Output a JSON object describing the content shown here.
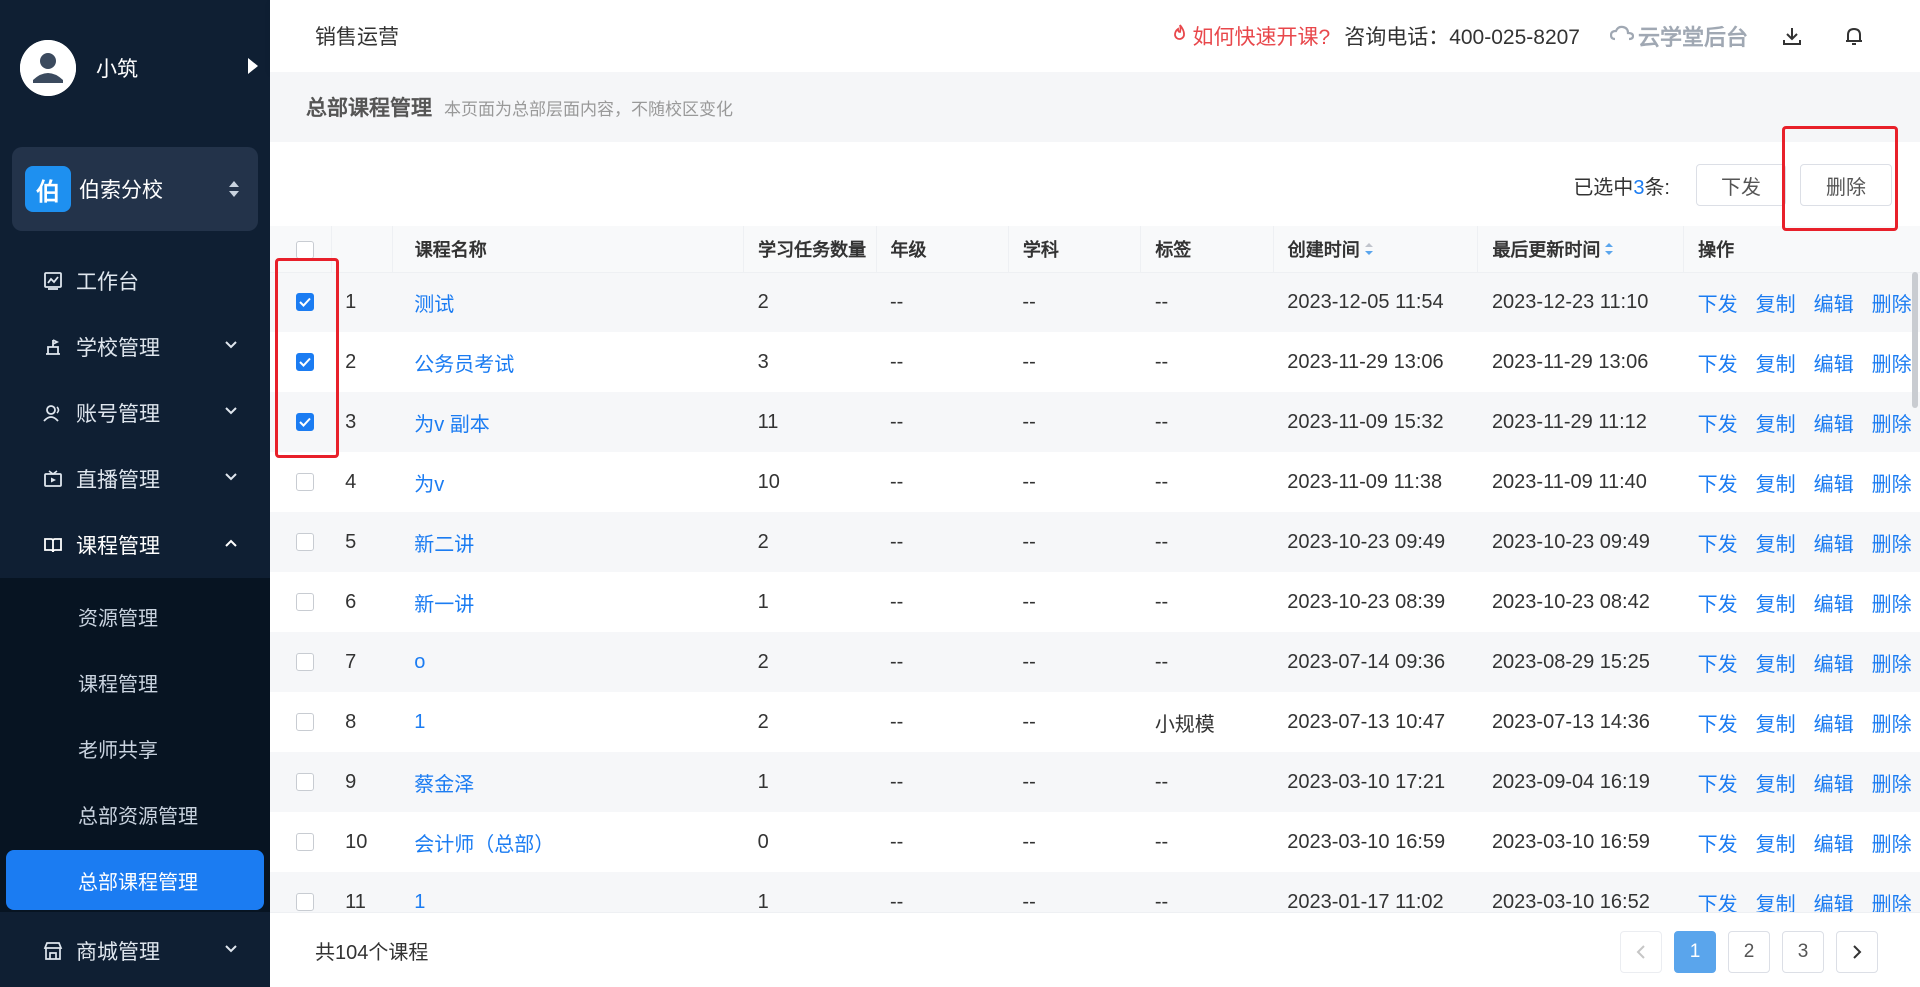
{
  "sidebar": {
    "user_name": "小筑",
    "school": {
      "logo_char": "伯",
      "name": "伯索分校"
    },
    "items": [
      {
        "label": "工作台",
        "icon": "dashboard-icon"
      },
      {
        "label": "学校管理",
        "icon": "school-icon"
      },
      {
        "label": "账号管理",
        "icon": "user-icon"
      },
      {
        "label": "直播管理",
        "icon": "live-icon"
      },
      {
        "label": "课程管理",
        "icon": "book-icon"
      },
      {
        "label": "商城管理",
        "icon": "store-icon"
      }
    ],
    "submenu": [
      "资源管理",
      "课程管理",
      "老师共享",
      "总部资源管理",
      "总部课程管理"
    ]
  },
  "header": {
    "title": "销售运营",
    "quick_link": "如何快速开课?",
    "phone": "咨询电话：400-025-8207",
    "brand": "云学堂后台"
  },
  "page": {
    "title": "总部课程管理",
    "description": "本页面为总部层面内容，不随校区变化"
  },
  "toolbar": {
    "selected_prefix": "已选中",
    "selected_count": "3",
    "selected_suffix": "条:",
    "send_label": "下发",
    "delete_label": "删除"
  },
  "table": {
    "headers": {
      "name": "课程名称",
      "tasks": "学习任务数量",
      "grade": "年级",
      "subject": "学科",
      "tag": "标签",
      "created": "创建时间",
      "updated": "最后更新时间",
      "ops": "操作"
    },
    "op_labels": [
      "下发",
      "复制",
      "编辑",
      "删除"
    ],
    "rows": [
      {
        "idx": "1",
        "name": "测试",
        "tasks": "2",
        "grade": "--",
        "subject": "--",
        "tag": "--",
        "created": "2023-12-05 11:54",
        "updated": "2023-12-23 11:10",
        "checked": true
      },
      {
        "idx": "2",
        "name": "公务员考试",
        "tasks": "3",
        "grade": "--",
        "subject": "--",
        "tag": "--",
        "created": "2023-11-29 13:06",
        "updated": "2023-11-29 13:06",
        "checked": true
      },
      {
        "idx": "3",
        "name": "为v 副本",
        "tasks": "11",
        "grade": "--",
        "subject": "--",
        "tag": "--",
        "created": "2023-11-09 15:32",
        "updated": "2023-11-29 11:12",
        "checked": true
      },
      {
        "idx": "4",
        "name": "为v",
        "tasks": "10",
        "grade": "--",
        "subject": "--",
        "tag": "--",
        "created": "2023-11-09 11:38",
        "updated": "2023-11-09 11:40",
        "checked": false
      },
      {
        "idx": "5",
        "name": "新二讲",
        "tasks": "2",
        "grade": "--",
        "subject": "--",
        "tag": "--",
        "created": "2023-10-23 09:49",
        "updated": "2023-10-23 09:49",
        "checked": false
      },
      {
        "idx": "6",
        "name": "新一讲",
        "tasks": "1",
        "grade": "--",
        "subject": "--",
        "tag": "--",
        "created": "2023-10-23 08:39",
        "updated": "2023-10-23 08:42",
        "checked": false
      },
      {
        "idx": "7",
        "name": "o",
        "tasks": "2",
        "grade": "--",
        "subject": "--",
        "tag": "--",
        "created": "2023-07-14 09:36",
        "updated": "2023-08-29 15:25",
        "checked": false
      },
      {
        "idx": "8",
        "name": "1",
        "tasks": "2",
        "grade": "--",
        "subject": "--",
        "tag": "小规模",
        "created": "2023-07-13 10:47",
        "updated": "2023-07-13 14:36",
        "checked": false
      },
      {
        "idx": "9",
        "name": "蔡金泽",
        "tasks": "1",
        "grade": "--",
        "subject": "--",
        "tag": "--",
        "created": "2023-03-10 17:21",
        "updated": "2023-09-04 16:19",
        "checked": false
      },
      {
        "idx": "10",
        "name": "会计师（总部）",
        "tasks": "0",
        "grade": "--",
        "subject": "--",
        "tag": "--",
        "created": "2023-03-10 16:59",
        "updated": "2023-03-10 16:59",
        "checked": false
      },
      {
        "idx": "11",
        "name": "1",
        "tasks": "1",
        "grade": "--",
        "subject": "--",
        "tag": "--",
        "created": "2023-01-17 11:02",
        "updated": "2023-03-10 16:52",
        "checked": false
      }
    ]
  },
  "footer": {
    "total": "共104个课程",
    "pages": [
      "1",
      "2",
      "3"
    ],
    "current_page": "1"
  },
  "colors": {
    "sidebar_bg": "#0f1f33",
    "accent": "#1b7cf2",
    "highlight": "#e8202a",
    "quick_link": "#e8474b"
  }
}
